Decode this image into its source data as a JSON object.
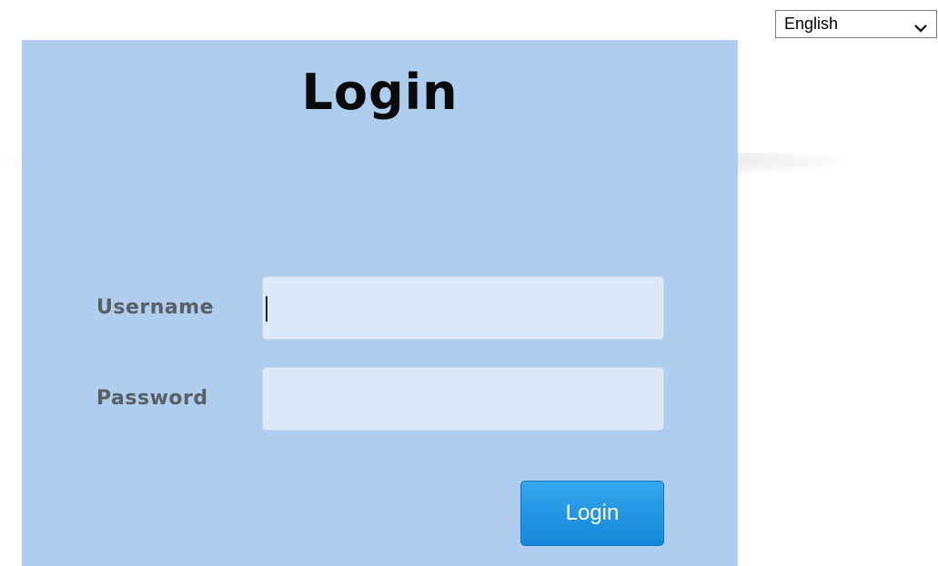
{
  "language_selector": {
    "selected": "English",
    "chevron_icon": "chevron-down-icon"
  },
  "login_panel": {
    "title": "Login",
    "background_color": "#aecdef",
    "username": {
      "label": "Username",
      "value": "",
      "placeholder": ""
    },
    "password": {
      "label": "Password",
      "value": "",
      "placeholder": ""
    },
    "submit_label": "Login",
    "button_color": "#1f93e0"
  }
}
